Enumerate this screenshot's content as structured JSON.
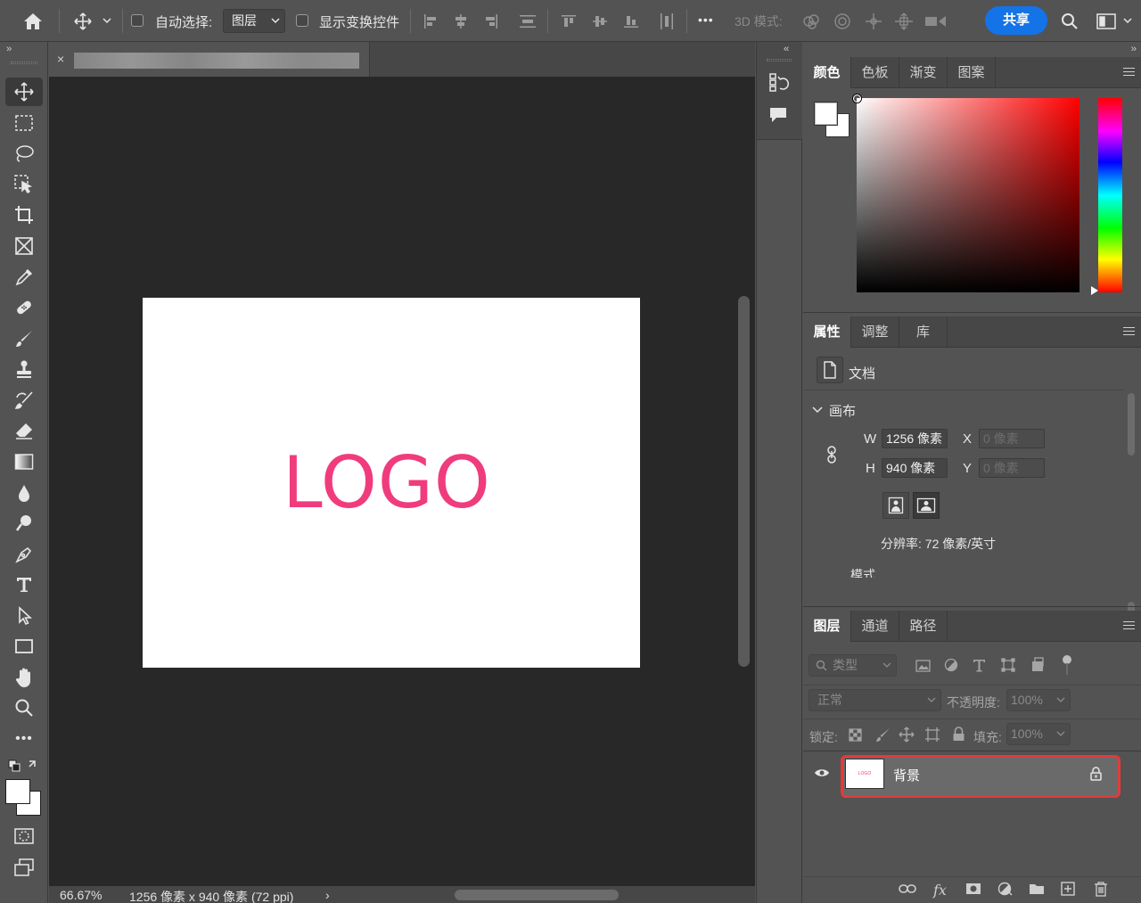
{
  "options_bar": {
    "auto_select_label": "自动选择:",
    "auto_select_value": "图层",
    "show_transform_label": "显示变换控件",
    "more_label": "•••",
    "mode_3d_label": "3D 模式:",
    "share_label": "共享"
  },
  "document": {
    "close_glyph": "×",
    "logo_text": "LOGO",
    "logo_color": "#f03c7c",
    "zoom": "66.67%",
    "dimensions": "1256 像素 x 940 像素 (72 ppi)",
    "status_arrow": "›"
  },
  "color_panel": {
    "tabs": [
      "颜色",
      "色板",
      "渐变",
      "图案"
    ],
    "foreground": "#ffffff",
    "background": "#ffffff"
  },
  "properties_panel": {
    "tabs": [
      "属性",
      "调整",
      "库"
    ],
    "doc_label": "文档",
    "canvas_section": "画布",
    "w_label": "W",
    "w_value": "1256 像素",
    "h_label": "H",
    "h_value": "940 像素",
    "x_label": "X",
    "x_value": "0 像素",
    "y_label": "Y",
    "y_value": "0 像素",
    "resolution": "分辨率: 72 像素/英寸",
    "mode_label": "模式"
  },
  "layers_panel": {
    "tabs": [
      "图层",
      "通道",
      "路径"
    ],
    "filter_placeholder": "类型",
    "blend_mode": "正常",
    "opacity_label": "不透明度:",
    "opacity_value": "100%",
    "lock_label": "锁定:",
    "fill_label": "填充:",
    "fill_value": "100%",
    "layers": [
      {
        "name": "背景",
        "thumb_text": "LOGO",
        "visible": true,
        "locked": true,
        "selected": true
      }
    ],
    "highlight_color": "#e23b3b"
  },
  "accent_color": "#1473e6"
}
